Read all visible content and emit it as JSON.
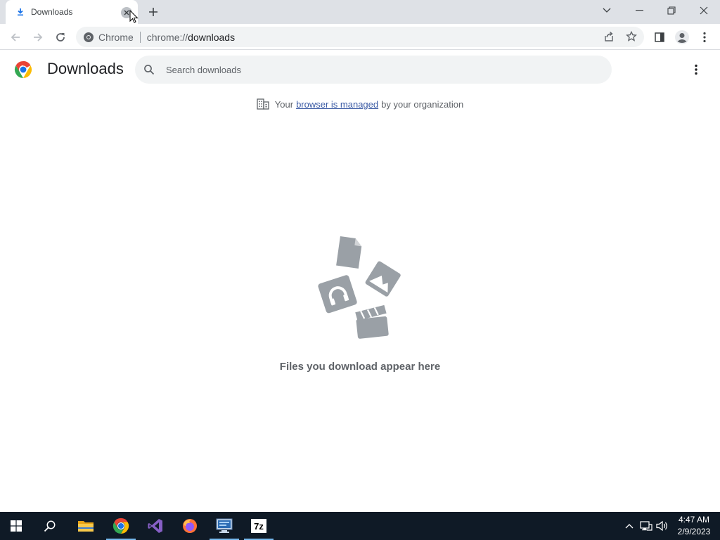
{
  "browser": {
    "tab": {
      "title": "Downloads",
      "icon": "download-icon"
    },
    "new_tab_icon": "plus-icon",
    "window_controls": [
      "tab-search-icon",
      "minimize-icon",
      "restore-icon",
      "close-icon"
    ]
  },
  "toolbar": {
    "omnibox": {
      "site_label": "Chrome",
      "url_scheme": "chrome://",
      "url_path": "downloads"
    }
  },
  "page": {
    "title": "Downloads",
    "search": {
      "placeholder": "Search downloads",
      "value": ""
    },
    "managed_notice": {
      "prefix": "Your",
      "link": "browser is managed",
      "suffix": "by your organization"
    },
    "empty_message": "Files you download appear here"
  },
  "taskbar": {
    "apps": [
      "start-icon",
      "search-icon",
      "file-explorer-icon",
      "chrome-icon",
      "visual-studio-icon",
      "firefox-icon",
      "remote-desktop-icon",
      "7zip-icon"
    ],
    "active_app": "chrome-icon",
    "sevenzip_label": "7z",
    "clock": {
      "time": "4:47 AM",
      "date": "2/9/2023"
    }
  },
  "colors": {
    "tab_strip": "#dee1e6",
    "omnibox": "#f1f3f4",
    "link": "#3b5ba5",
    "taskbar": "#0f1a26",
    "empty_art": "#9aa0a6"
  }
}
